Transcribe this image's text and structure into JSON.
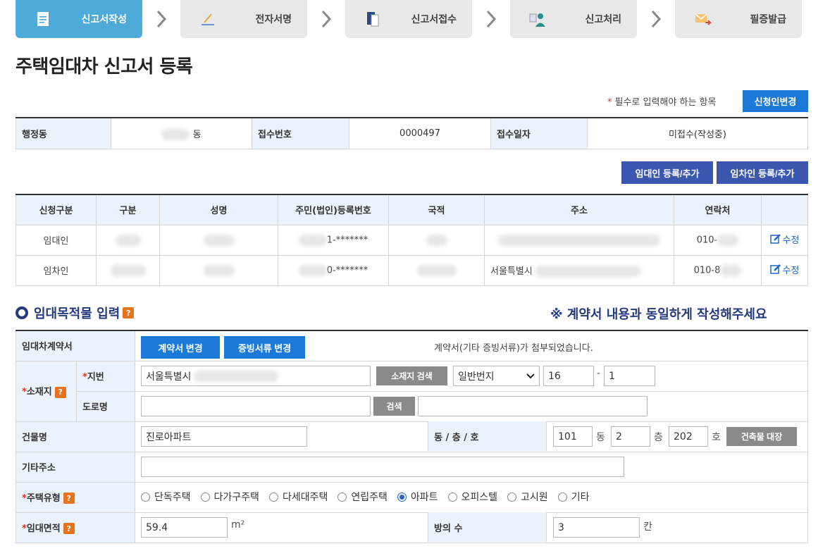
{
  "steps": [
    {
      "label": "신고서작성",
      "icon": "document-icon",
      "active": true
    },
    {
      "label": "전자서명",
      "icon": "pen-sign-icon",
      "active": false
    },
    {
      "label": "신고서접수",
      "icon": "file-stack-icon",
      "active": false
    },
    {
      "label": "신고처리",
      "icon": "person-desk-icon",
      "active": false
    },
    {
      "label": "필증발급",
      "icon": "envelope-arrow-icon",
      "active": false
    }
  ],
  "page_title": "주택임대차 신고서 등록",
  "required_note": "필수로 입력해야 하는 항목",
  "required_star": "*",
  "change_applicant_btn": "신청인변경",
  "info": {
    "dong_label": "행정동",
    "dong_value": "동",
    "receipt_no_label": "접수번호",
    "receipt_no_value": "0000497",
    "receipt_date_label": "접수일자",
    "receipt_date_value": "미접수(작성중)"
  },
  "buttons": {
    "lessor_add": "임대인 등록/추가",
    "lessee_add": "임차인 등록/추가"
  },
  "party_table": {
    "headers": [
      "신청구분",
      "구분",
      "성명",
      "주민(법인)등록번호",
      "국적",
      "주소",
      "연락처",
      ""
    ],
    "rows": [
      {
        "type": "임대인",
        "reg_no": "1-*******",
        "address": "",
        "phone": "010-",
        "edit": "수정"
      },
      {
        "type": "임차인",
        "reg_no": "0-*******",
        "address": "서울특별시",
        "phone": "010-8",
        "edit": "수정"
      }
    ]
  },
  "section_title": "임대목적물 입력",
  "notice": "※ 계약서 내용과 동일하게 작성해주세요",
  "form": {
    "contract_label": "임대차계약서",
    "contract_change_btn": "계약서 변경",
    "evidence_change_btn": "증빙서류 변경",
    "contract_status": "계약서(기타 증빙서류)가 첨부되었습니다.",
    "location_label": "소재지",
    "lot_label": "지번",
    "lot_address": "서울특별시",
    "lot_search_btn": "소재지 검색",
    "lot_type": "일반번지",
    "lot_main_no": "16",
    "lot_dash": "-",
    "lot_sub_no": "1",
    "road_label": "도로명",
    "road_search_btn": "검색",
    "building_label": "건물명",
    "building_name": "진로아파트",
    "dong_floor_ho_label": "동 / 층 / 호",
    "dong_no": "101",
    "dong_unit": "동",
    "floor_no": "2",
    "floor_unit": "층",
    "ho_no": "202",
    "ho_unit": "호",
    "ledger_btn": "건축물 대장",
    "etc_address_label": "기타주소",
    "house_type_label": "주택유형",
    "house_types": [
      "단독주택",
      "다가구주택",
      "다세대주택",
      "연립주택",
      "아파트",
      "오피스텔",
      "고시원",
      "기타"
    ],
    "house_type_selected": "아파트",
    "area_label": "임대면적",
    "area_value": "59.4",
    "area_unit": "m²",
    "rooms_label": "방의 수",
    "rooms_value": "3",
    "rooms_unit": "칸"
  },
  "colors": {
    "active_step": "#4eaad8",
    "primary_blue": "#1b7ad8",
    "navy": "#3b56ae",
    "header_bg": "#eaf3fb",
    "required": "#e03a24"
  }
}
